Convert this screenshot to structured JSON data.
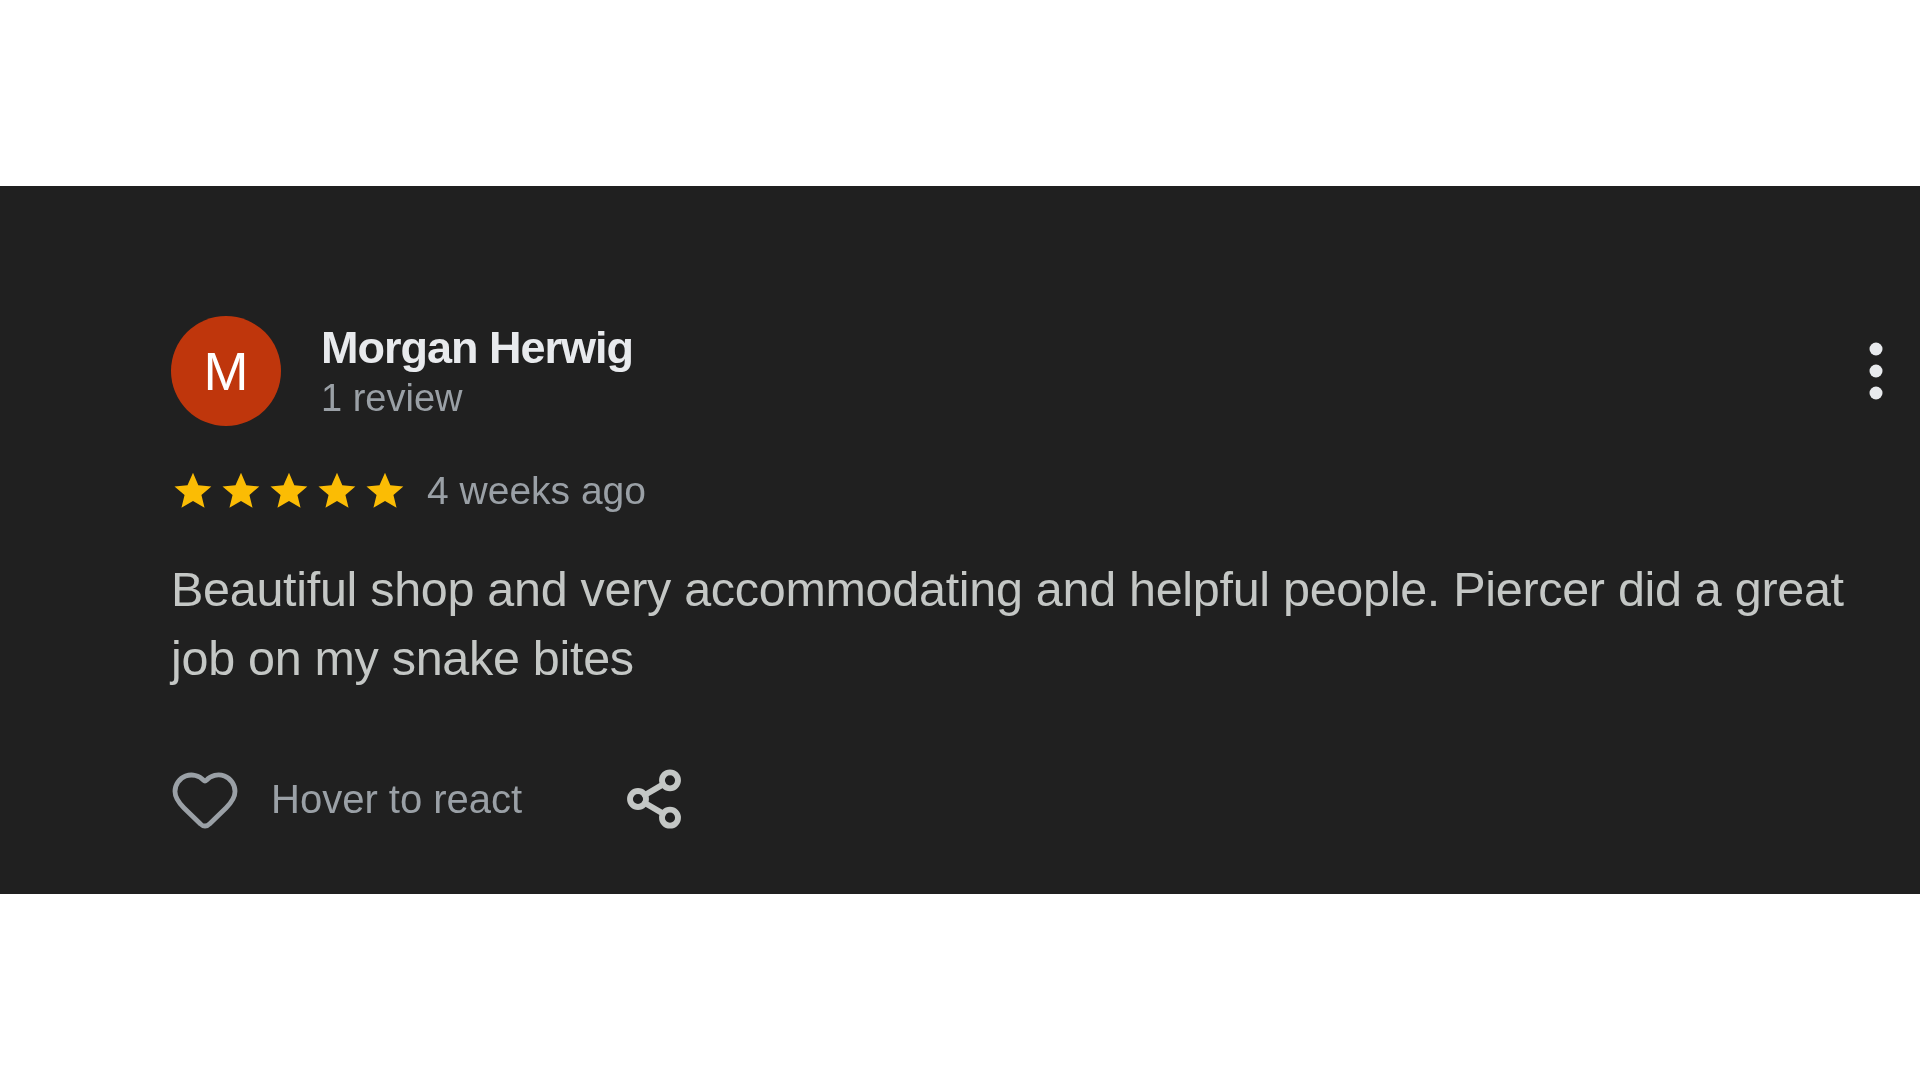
{
  "review": {
    "avatar": {
      "letter": "M",
      "color": "#bf360c"
    },
    "author": "Morgan Herwig",
    "review_count": "1 review",
    "stars": 5,
    "time": "4 weeks ago",
    "text": "Beautiful shop and very accommodating and helpful people. Piercer did a great job on my snake bites",
    "react_label": "Hover to react"
  }
}
